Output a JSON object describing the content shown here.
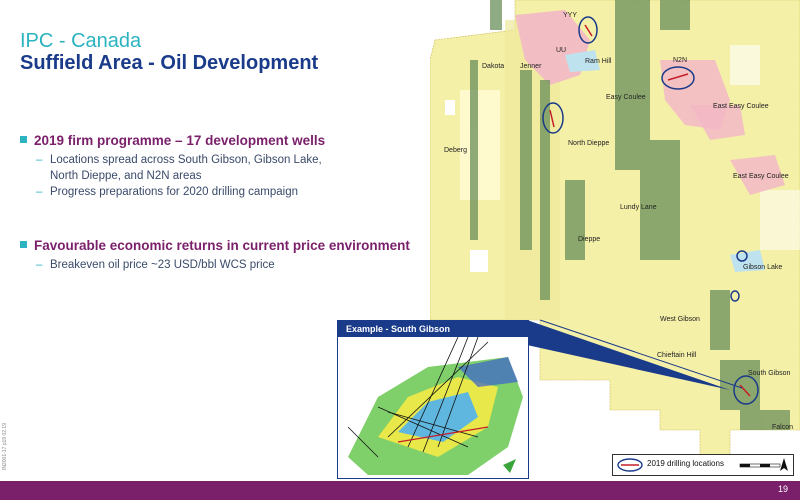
{
  "header": {
    "title_line1": "IPC - Canada",
    "title_line2": "Suffield Area - Oil Development"
  },
  "bullets": [
    {
      "heading": "2019 firm programme – 17 development wells",
      "subs": [
        "Locations spread across South Gibson, Gibson Lake,",
        "North Dieppe, and N2N areas",
        "Progress preparations for 2020 drilling campaign"
      ]
    },
    {
      "heading": "Favourable economic returns in current price environment",
      "subs": [
        "Breakeven oil price ~23 USD/bbl WCS price"
      ]
    }
  ],
  "map": {
    "labels": {
      "yyy": "YYY",
      "uu": "UU",
      "ram_hill": "Ram Hill",
      "dakota": "Dakota",
      "jenner": "Jenner",
      "n2n": "N2N",
      "easy_coulee": "Easy Coulee",
      "east_easy_coulee_1": "East Easy Coulee",
      "east_easy_coulee_2": "East Easy Coulee",
      "deberg": "Deberg",
      "north_dieppe": "North Dieppe",
      "lundy_lane": "Lundy Lane",
      "dieppe": "Dieppe",
      "gibson_lake": "Gibson Lake",
      "west_gibson": "West Gibson",
      "chieftain_hill": "Chieftain Hill",
      "south_gibson": "South Gibson",
      "falcon": "Falcon"
    }
  },
  "inset": {
    "title": "Example - South Gibson"
  },
  "legend": {
    "label": "2019 drilling locations"
  },
  "footer": {
    "page_number": "19",
    "side_code": "IN2001-17 p19 02.19"
  },
  "colors": {
    "title_teal": "#2bb3c0",
    "title_navy": "#1a3a8a",
    "accent_purple": "#7a1f6a",
    "map_yellow": "#f5f0a8",
    "map_pink": "#f2b8c6",
    "well_green": "#6a8f5a",
    "circle_blue": "#1a3a8a",
    "well_red": "#c41e2a"
  }
}
